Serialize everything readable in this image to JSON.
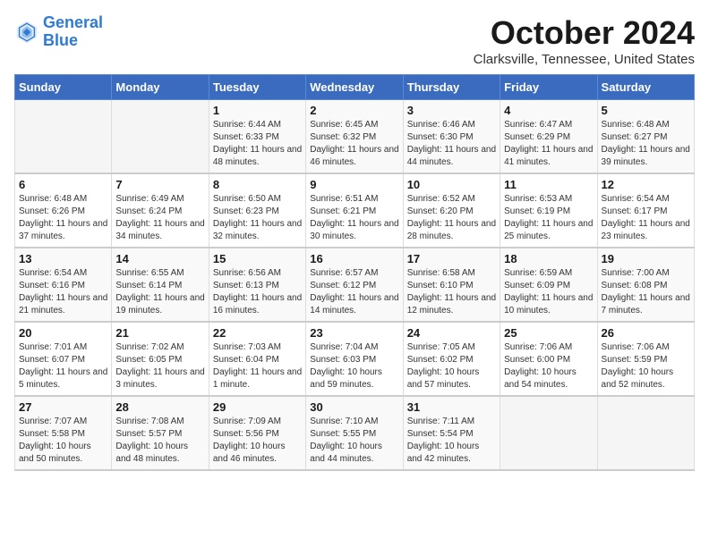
{
  "header": {
    "logo_line1": "General",
    "logo_line2": "Blue",
    "month": "October 2024",
    "location": "Clarksville, Tennessee, United States"
  },
  "days_of_week": [
    "Sunday",
    "Monday",
    "Tuesday",
    "Wednesday",
    "Thursday",
    "Friday",
    "Saturday"
  ],
  "weeks": [
    [
      {
        "day": "",
        "detail": ""
      },
      {
        "day": "",
        "detail": ""
      },
      {
        "day": "1",
        "detail": "Sunrise: 6:44 AM\nSunset: 6:33 PM\nDaylight: 11 hours and 48 minutes."
      },
      {
        "day": "2",
        "detail": "Sunrise: 6:45 AM\nSunset: 6:32 PM\nDaylight: 11 hours and 46 minutes."
      },
      {
        "day": "3",
        "detail": "Sunrise: 6:46 AM\nSunset: 6:30 PM\nDaylight: 11 hours and 44 minutes."
      },
      {
        "day": "4",
        "detail": "Sunrise: 6:47 AM\nSunset: 6:29 PM\nDaylight: 11 hours and 41 minutes."
      },
      {
        "day": "5",
        "detail": "Sunrise: 6:48 AM\nSunset: 6:27 PM\nDaylight: 11 hours and 39 minutes."
      }
    ],
    [
      {
        "day": "6",
        "detail": "Sunrise: 6:48 AM\nSunset: 6:26 PM\nDaylight: 11 hours and 37 minutes."
      },
      {
        "day": "7",
        "detail": "Sunrise: 6:49 AM\nSunset: 6:24 PM\nDaylight: 11 hours and 34 minutes."
      },
      {
        "day": "8",
        "detail": "Sunrise: 6:50 AM\nSunset: 6:23 PM\nDaylight: 11 hours and 32 minutes."
      },
      {
        "day": "9",
        "detail": "Sunrise: 6:51 AM\nSunset: 6:21 PM\nDaylight: 11 hours and 30 minutes."
      },
      {
        "day": "10",
        "detail": "Sunrise: 6:52 AM\nSunset: 6:20 PM\nDaylight: 11 hours and 28 minutes."
      },
      {
        "day": "11",
        "detail": "Sunrise: 6:53 AM\nSunset: 6:19 PM\nDaylight: 11 hours and 25 minutes."
      },
      {
        "day": "12",
        "detail": "Sunrise: 6:54 AM\nSunset: 6:17 PM\nDaylight: 11 hours and 23 minutes."
      }
    ],
    [
      {
        "day": "13",
        "detail": "Sunrise: 6:54 AM\nSunset: 6:16 PM\nDaylight: 11 hours and 21 minutes."
      },
      {
        "day": "14",
        "detail": "Sunrise: 6:55 AM\nSunset: 6:14 PM\nDaylight: 11 hours and 19 minutes."
      },
      {
        "day": "15",
        "detail": "Sunrise: 6:56 AM\nSunset: 6:13 PM\nDaylight: 11 hours and 16 minutes."
      },
      {
        "day": "16",
        "detail": "Sunrise: 6:57 AM\nSunset: 6:12 PM\nDaylight: 11 hours and 14 minutes."
      },
      {
        "day": "17",
        "detail": "Sunrise: 6:58 AM\nSunset: 6:10 PM\nDaylight: 11 hours and 12 minutes."
      },
      {
        "day": "18",
        "detail": "Sunrise: 6:59 AM\nSunset: 6:09 PM\nDaylight: 11 hours and 10 minutes."
      },
      {
        "day": "19",
        "detail": "Sunrise: 7:00 AM\nSunset: 6:08 PM\nDaylight: 11 hours and 7 minutes."
      }
    ],
    [
      {
        "day": "20",
        "detail": "Sunrise: 7:01 AM\nSunset: 6:07 PM\nDaylight: 11 hours and 5 minutes."
      },
      {
        "day": "21",
        "detail": "Sunrise: 7:02 AM\nSunset: 6:05 PM\nDaylight: 11 hours and 3 minutes."
      },
      {
        "day": "22",
        "detail": "Sunrise: 7:03 AM\nSunset: 6:04 PM\nDaylight: 11 hours and 1 minute."
      },
      {
        "day": "23",
        "detail": "Sunrise: 7:04 AM\nSunset: 6:03 PM\nDaylight: 10 hours and 59 minutes."
      },
      {
        "day": "24",
        "detail": "Sunrise: 7:05 AM\nSunset: 6:02 PM\nDaylight: 10 hours and 57 minutes."
      },
      {
        "day": "25",
        "detail": "Sunrise: 7:06 AM\nSunset: 6:00 PM\nDaylight: 10 hours and 54 minutes."
      },
      {
        "day": "26",
        "detail": "Sunrise: 7:06 AM\nSunset: 5:59 PM\nDaylight: 10 hours and 52 minutes."
      }
    ],
    [
      {
        "day": "27",
        "detail": "Sunrise: 7:07 AM\nSunset: 5:58 PM\nDaylight: 10 hours and 50 minutes."
      },
      {
        "day": "28",
        "detail": "Sunrise: 7:08 AM\nSunset: 5:57 PM\nDaylight: 10 hours and 48 minutes."
      },
      {
        "day": "29",
        "detail": "Sunrise: 7:09 AM\nSunset: 5:56 PM\nDaylight: 10 hours and 46 minutes."
      },
      {
        "day": "30",
        "detail": "Sunrise: 7:10 AM\nSunset: 5:55 PM\nDaylight: 10 hours and 44 minutes."
      },
      {
        "day": "31",
        "detail": "Sunrise: 7:11 AM\nSunset: 5:54 PM\nDaylight: 10 hours and 42 minutes."
      },
      {
        "day": "",
        "detail": ""
      },
      {
        "day": "",
        "detail": ""
      }
    ]
  ]
}
